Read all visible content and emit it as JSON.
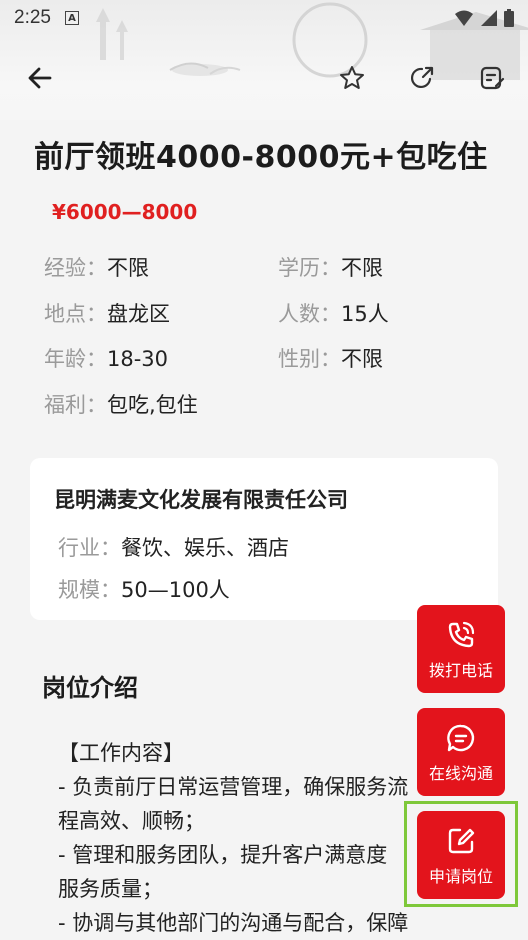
{
  "status_bar": {
    "time": "2:25",
    "notif_letter": "A"
  },
  "toolbar": {
    "back_icon": "arrow-left-icon",
    "favorite_icon": "star-icon",
    "share_icon": "share-icon",
    "report_icon": "edit-note-icon"
  },
  "job": {
    "title": "前厅领班4000-8000元+包吃住",
    "salary": "¥6000—8000",
    "info": [
      {
        "label": "经验：",
        "value": "不限"
      },
      {
        "label": "学历：",
        "value": "不限"
      },
      {
        "label": "地点：",
        "value": "盘龙区"
      },
      {
        "label": "人数：",
        "value": "15人"
      },
      {
        "label": "年龄：",
        "value": "18-30"
      },
      {
        "label": "性别：",
        "value": "不限"
      },
      {
        "label": "福利：",
        "value": "包吃,包住"
      }
    ]
  },
  "company": {
    "name": "昆明满麦文化发展有限责任公司",
    "industry_label": "行业：",
    "industry_value": "餐饮、娱乐、酒店",
    "scale_label": "规模：",
    "scale_value": "50—100人"
  },
  "section": {
    "title": "岗位介绍",
    "lines": [
      "【工作内容】",
      "- 负责前厅日常运营管理，确保服务流",
      "程高效、顺畅；",
      "- 管理和服务团队，提升客户满意度",
      "服务质量；",
      "- 协调与其他部门的沟通与配合，保障"
    ]
  },
  "fabs": {
    "call_label": "拨打电话",
    "chat_label": "在线沟通",
    "apply_label": "申请岗位"
  },
  "colors": {
    "accent": "#e3141c",
    "salary": "#e02020",
    "highlight": "#7ec83a"
  }
}
